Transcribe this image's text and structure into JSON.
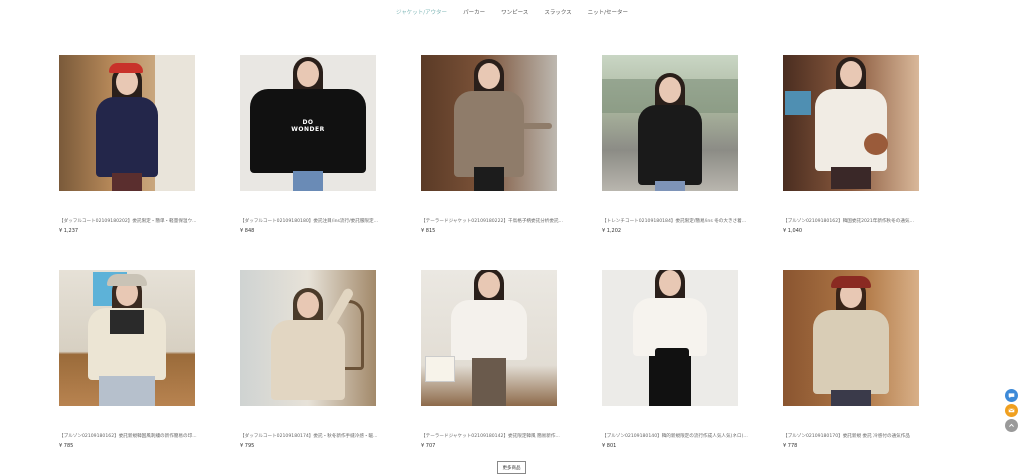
{
  "nav": {
    "items": [
      {
        "label": "ジャケット/アウター",
        "active": true
      },
      {
        "label": "パーカー",
        "active": false
      },
      {
        "label": "ワンピース",
        "active": false
      },
      {
        "label": "スラックス",
        "active": false
      },
      {
        "label": "ニット/セーター",
        "active": false
      }
    ]
  },
  "products": [
    {
      "title": "【ダッフルコート02109180202】委託限定・簡単・軽量保温ウ...",
      "price": "¥ 1,237"
    },
    {
      "title": "【ダッフルコート02109180180】委託注目/ins流行/委託服限定...",
      "price": "¥ 848"
    },
    {
      "title": "【テーラードジャケット02109180222】千鳥格子柄委託分析委託...",
      "price": "¥ 815"
    },
    {
      "title": "【トレンチコート02109180184】委託限定/簡易/ins 冬の大きさ着...",
      "price": "¥ 1,202"
    },
    {
      "title": "【ブルゾン02109180162】韓国委託2021年新作秋冬の通気...",
      "price": "¥ 1,040"
    },
    {
      "title": "【ブルゾン02109180162】委託新規韓国風刺繍の新作簡易の印...",
      "price": "¥ 785"
    },
    {
      "title": "【ダッフルコート02109180174】委託・秋冬新作手縫冷感・暖...",
      "price": "¥ 795"
    },
    {
      "title": "【テーラードジャケット02109180142】委託限定韓風 簡易新作...",
      "price": "¥ 707"
    },
    {
      "title": "【ブルゾン02109180140】韓的新規限定の流行作成人気人気(ネロ)...",
      "price": "¥ 801"
    },
    {
      "title": "【ブルゾン02109180170】委託新規 委託 冷感付の通気作品",
      "price": "¥ 778"
    }
  ],
  "more_label": "更多商品",
  "floating": {
    "chat_icon": "chat-icon",
    "mail_icon": "mail-icon",
    "top_icon": "arrow-up-icon",
    "colors": {
      "chat": "#3d8ad8",
      "mail": "#f0a020",
      "top": "#9a9a9a"
    }
  }
}
